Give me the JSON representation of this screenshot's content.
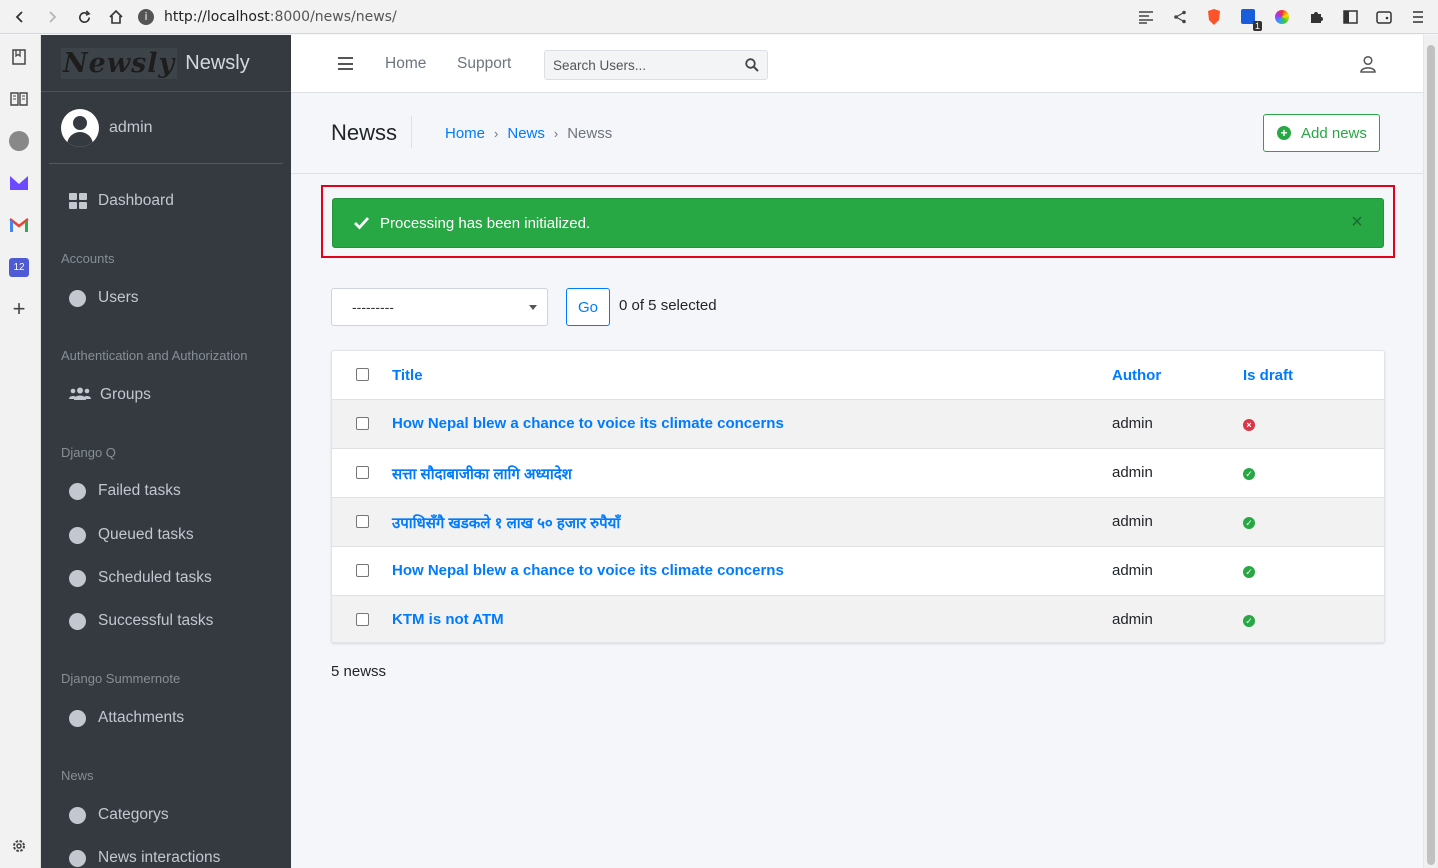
{
  "browser": {
    "url_host": "http://localhost",
    "url_path": ":8000/news/news/",
    "calendar_badge": "12",
    "ext_badge": "1"
  },
  "sidebar": {
    "brand_logo": "Newsly",
    "brand_name": "Newsly",
    "user_name": "admin",
    "dashboard": "Dashboard",
    "sections": [
      {
        "header": "Accounts",
        "items": [
          "Users"
        ]
      },
      {
        "header": "Authentication and Authorization",
        "items": [
          "Groups"
        ]
      },
      {
        "header": "Django Q",
        "items": [
          "Failed tasks",
          "Queued tasks",
          "Scheduled tasks",
          "Successful tasks"
        ]
      },
      {
        "header": "Django Summernote",
        "items": [
          "Attachments"
        ]
      },
      {
        "header": "News",
        "items": [
          "Categorys",
          "News interactions"
        ]
      }
    ]
  },
  "topnav": {
    "home": "Home",
    "support": "Support",
    "search_placeholder": "Search Users..."
  },
  "page": {
    "title": "Newss",
    "breadcrumb": [
      "Home",
      "News",
      "Newss"
    ],
    "add_button": "Add news"
  },
  "alert": {
    "message": "Processing has been initialized.",
    "close": "×"
  },
  "actions": {
    "selected_value": "---------",
    "go_label": "Go",
    "selected_count": "0 of 5 selected"
  },
  "table": {
    "headers": {
      "title": "Title",
      "author": "Author",
      "is_draft": "Is draft"
    },
    "rows": [
      {
        "title": "How Nepal blew a chance to voice its climate concerns",
        "author": "admin",
        "is_draft": false
      },
      {
        "title": "सत्ता सौदाबाजीका लागि अध्यादेश",
        "author": "admin",
        "is_draft": true
      },
      {
        "title": "उपाधिसँगै खडकले १ लाख ५० हजार रुपैयाँ",
        "author": "admin",
        "is_draft": true
      },
      {
        "title": "How Nepal blew a chance to voice its climate concerns",
        "author": "admin",
        "is_draft": true
      },
      {
        "title": "KTM is not ATM",
        "author": "admin",
        "is_draft": true
      }
    ]
  },
  "result_count": "5 newss",
  "colors": {
    "accent": "#007bff",
    "success": "#28a745",
    "danger": "#dc3545",
    "sidebar_bg": "#343a40",
    "highlight": "#e3001b"
  }
}
